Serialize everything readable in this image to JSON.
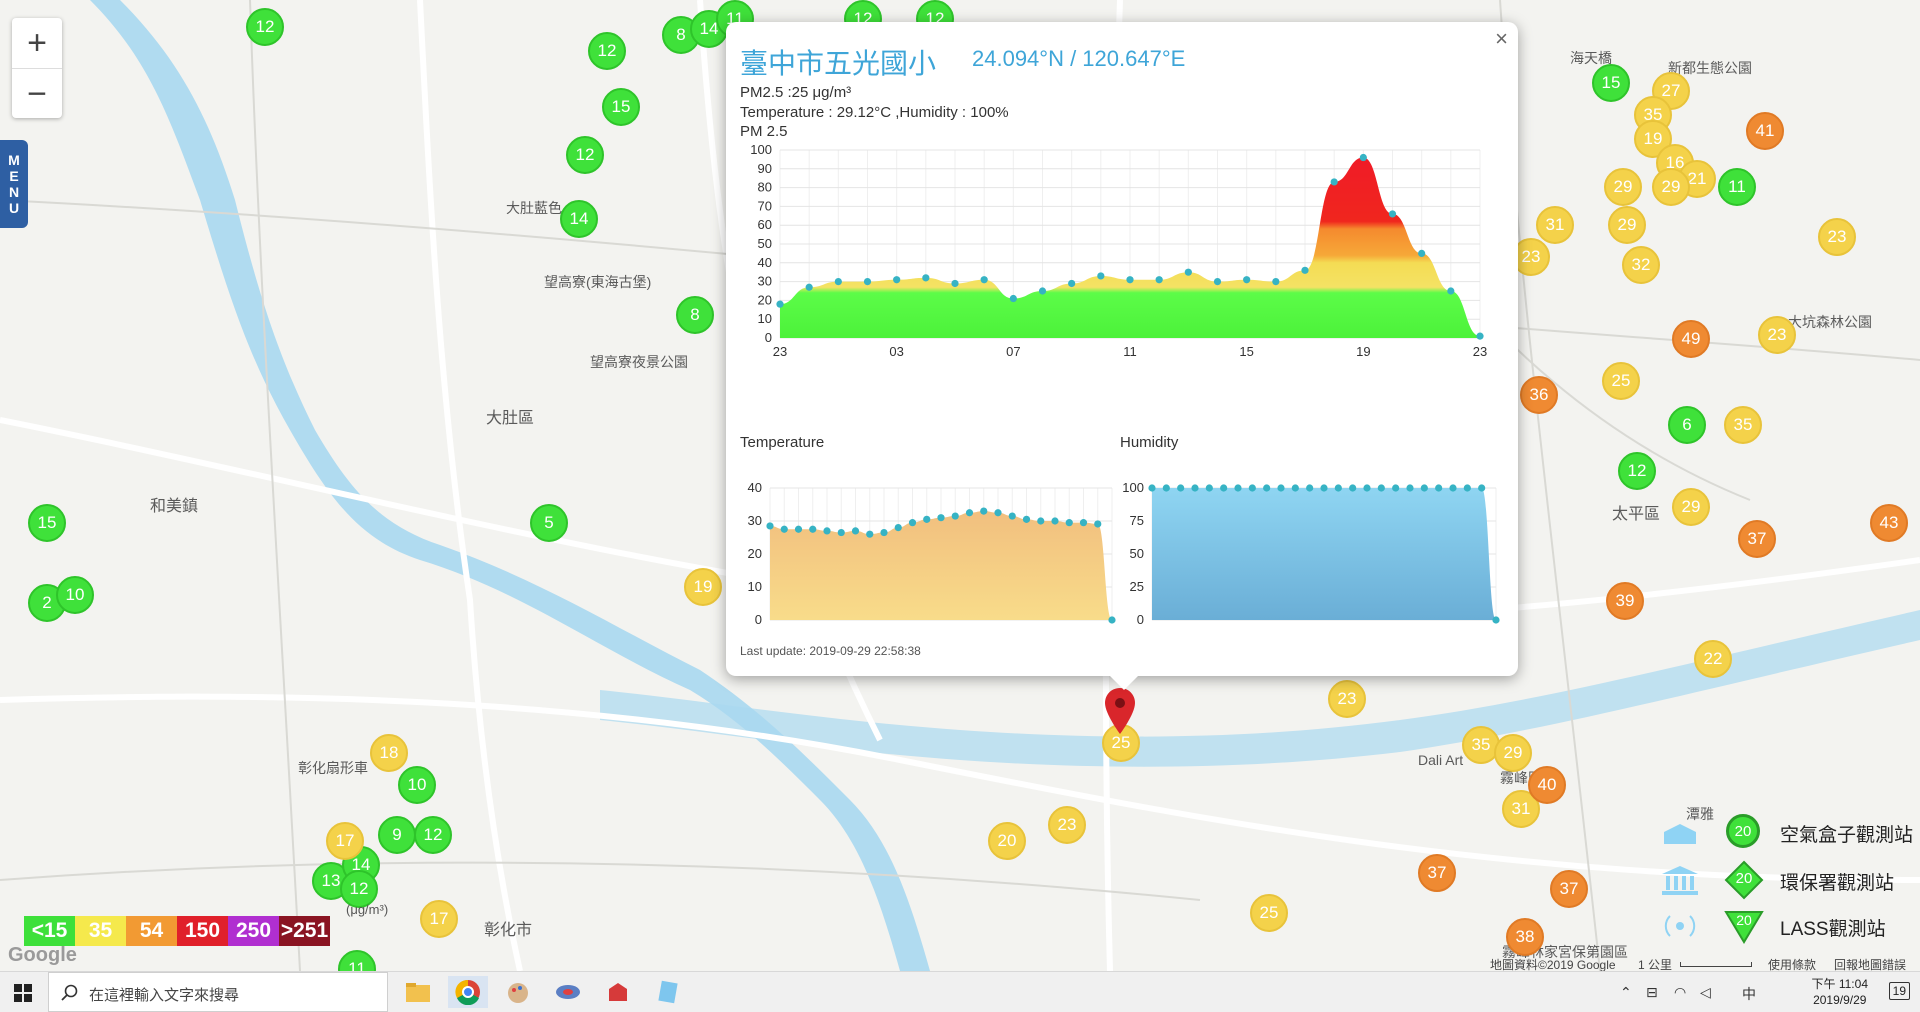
{
  "zoom": {
    "in": "+",
    "out": "−"
  },
  "menu": {
    "label": [
      "M",
      "E",
      "N",
      "U"
    ]
  },
  "places": [
    "大肚區",
    "和美鎮",
    "彰化市",
    "太平區",
    "望高寮夜景公園",
    "望高寮(東海古堡)",
    "大肚藍色",
    "彰化扇形車",
    "新都生態公園",
    "海天橋",
    "大坑森林公園",
    "霧峰林家宮保第園區",
    "Dali Art",
    "潭雅",
    "霧峰區"
  ],
  "markers": {
    "green": [
      "12",
      "8",
      "14",
      "11",
      "12",
      "12",
      "12",
      "15",
      "12",
      "14",
      "8",
      "15",
      "5",
      "2",
      "10",
      "10",
      "9",
      "12",
      "13",
      "14",
      "12",
      "11",
      "15",
      "11",
      "6",
      "12"
    ],
    "yellow": [
      "19",
      "18",
      "17",
      "17",
      "23",
      "25",
      "23",
      "20",
      "25",
      "35",
      "29",
      "22",
      "27",
      "35",
      "19",
      "16",
      "21",
      "29",
      "29",
      "29",
      "31",
      "32",
      "23",
      "25",
      "35",
      "29",
      "23",
      "31",
      "23"
    ],
    "orange": [
      "41",
      "49",
      "36",
      "43",
      "37",
      "39",
      "40",
      "37",
      "37",
      "38"
    ]
  },
  "popup": {
    "title": "臺中市五光國小",
    "coords": "24.094°N / 120.647°E",
    "close": "×",
    "pm25": "PM2.5 :25 μg/m³",
    "temp_hum": "Temperature : 29.12°C ,Humidity : 100%",
    "chart_title": "PM 2.5",
    "temp_label": "Temperature",
    "hum_label": "Humidity",
    "last_update": "Last update: 2019-09-29 22:58:38"
  },
  "chart_data": [
    {
      "type": "area",
      "title": "PM 2.5",
      "x": [
        "23",
        "00",
        "01",
        "02",
        "03",
        "04",
        "05",
        "06",
        "07",
        "08",
        "09",
        "10",
        "11",
        "12",
        "13",
        "14",
        "15",
        "16",
        "17",
        "18",
        "19",
        "20",
        "21",
        "22",
        "23"
      ],
      "xticks": [
        "23",
        "03",
        "07",
        "11",
        "15",
        "19",
        "23"
      ],
      "values": [
        18,
        27,
        30,
        30,
        31,
        32,
        29,
        31,
        21,
        25,
        29,
        33,
        31,
        31,
        35,
        30,
        31,
        30,
        36,
        83,
        96,
        66,
        45,
        25,
        1
      ],
      "ylim": [
        0,
        100
      ],
      "yticks": [
        0,
        10,
        20,
        30,
        40,
        50,
        60,
        70,
        80,
        90,
        100
      ],
      "grid": true
    },
    {
      "type": "area",
      "title": "Temperature",
      "values": [
        28.5,
        27.5,
        27.5,
        27.5,
        27,
        26.5,
        27,
        26,
        26.5,
        28,
        29.5,
        30.5,
        31,
        31.5,
        32.5,
        33,
        32.5,
        31.5,
        30.5,
        30,
        30,
        29.5,
        29.5,
        29.1,
        0
      ],
      "ylim": [
        0,
        40
      ],
      "yticks": [
        0,
        10,
        20,
        30,
        40
      ],
      "grid": true
    },
    {
      "type": "area",
      "title": "Humidity",
      "values": [
        100,
        100,
        100,
        100,
        100,
        100,
        100,
        100,
        100,
        100,
        100,
        100,
        100,
        100,
        100,
        100,
        100,
        100,
        100,
        100,
        100,
        100,
        100,
        100,
        0
      ],
      "ylim": [
        0,
        100
      ],
      "yticks": [
        0,
        25,
        50,
        75,
        100
      ],
      "grid": true
    }
  ],
  "legend": {
    "scale": [
      {
        "label": "<15",
        "color": "#3de03a"
      },
      {
        "label": "35",
        "color": "#f5e94c"
      },
      {
        "label": "54",
        "color": "#f29a33"
      },
      {
        "label": "150",
        "color": "#e0202a"
      },
      {
        "label": "250",
        "color": "#b02fd0"
      },
      {
        "label": ">251",
        "color": "#8a1422"
      }
    ],
    "unit": "(μg/m³)",
    "types": [
      {
        "label": "空氣盒子觀測站",
        "value": "20"
      },
      {
        "label": "環保署觀測站",
        "value": "20"
      },
      {
        "label": "LASS觀測站",
        "value": "20"
      }
    ]
  },
  "attribution": {
    "map_data": "地圖資料©2019 Google",
    "scale": "1 公里",
    "terms": "使用條款",
    "report": "回報地圖錯誤",
    "google": "Google"
  },
  "taskbar": {
    "search_placeholder": "在這裡輸入文字來搜尋",
    "time": "下午 11:04",
    "date": "2019/9/29",
    "ime": "中",
    "notif": "19"
  },
  "colors": {
    "accent": "#3ea5d8",
    "green": "#3fe13a",
    "yellow": "#f4d24a",
    "orange": "#ef8a32"
  }
}
